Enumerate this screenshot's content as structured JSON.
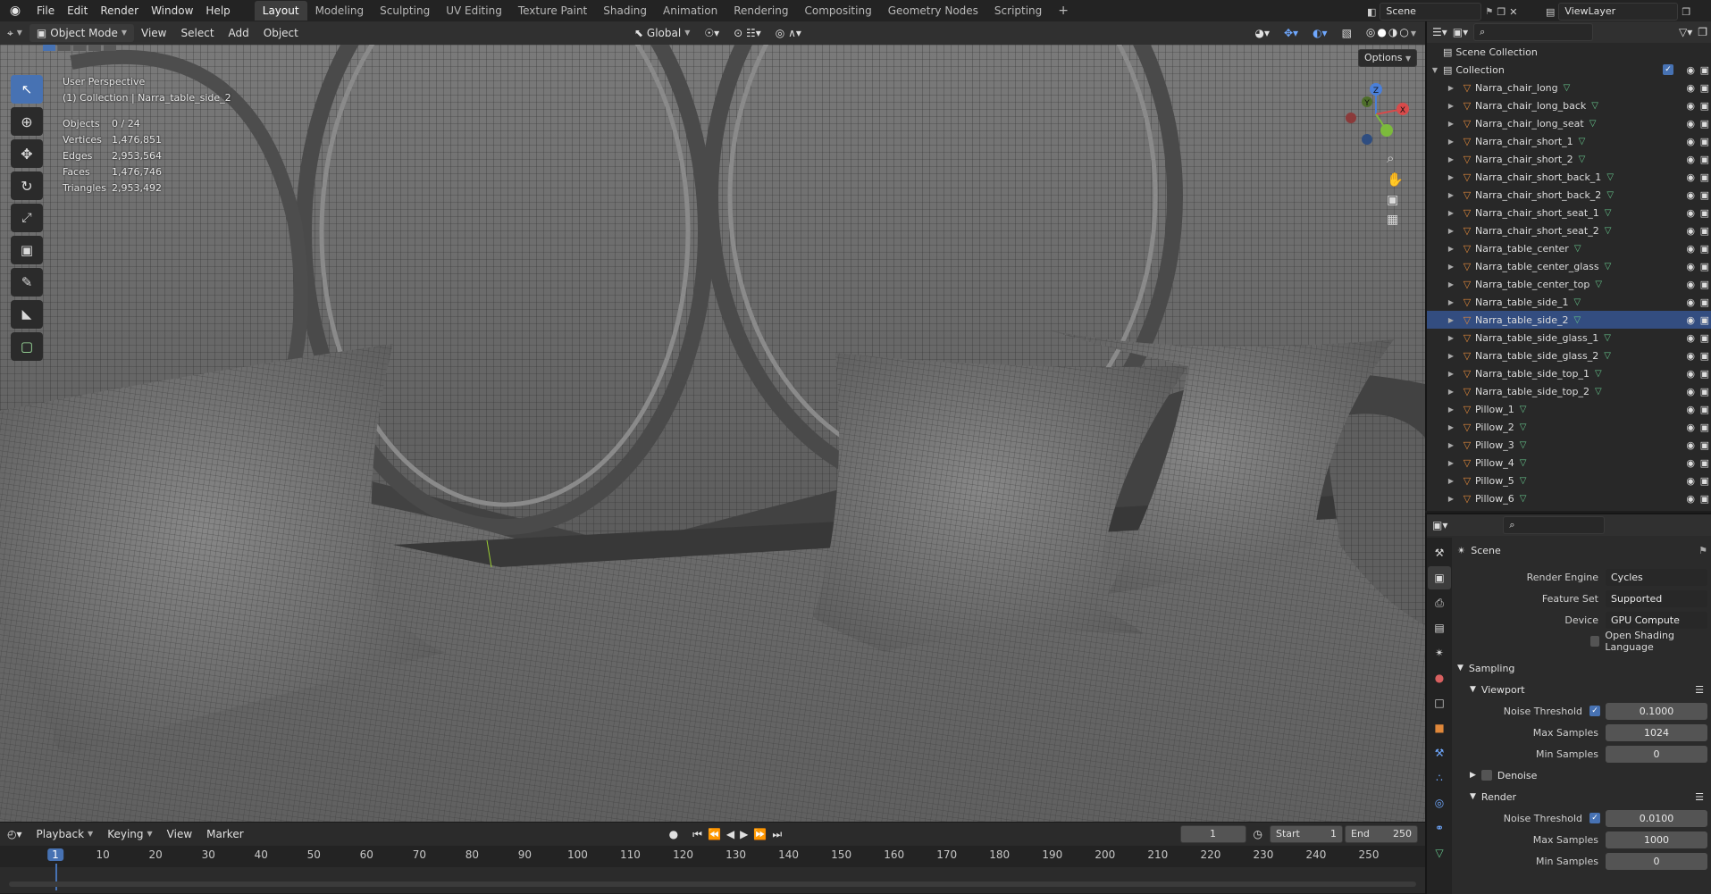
{
  "topbar": {
    "menus": [
      "File",
      "Edit",
      "Render",
      "Window",
      "Help"
    ],
    "workspaces": [
      "Layout",
      "Modeling",
      "Sculpting",
      "UV Editing",
      "Texture Paint",
      "Shading",
      "Animation",
      "Rendering",
      "Compositing",
      "Geometry Nodes",
      "Scripting"
    ],
    "active_workspace": "Layout",
    "add_workspace": "+",
    "scene": "Scene",
    "view_layer": "ViewLayer"
  },
  "viewport_header": {
    "mode": "Object Mode",
    "menus": [
      "View",
      "Select",
      "Add",
      "Object"
    ],
    "transform_orientation": "Global",
    "options": "Options"
  },
  "viewport": {
    "perspective": "User Perspective",
    "collection_info": "(1) Collection | Narra_table_side_2",
    "stats": [
      {
        "label": "Objects",
        "value": "0 / 24"
      },
      {
        "label": "Vertices",
        "value": "1,476,851"
      },
      {
        "label": "Edges",
        "value": "2,953,564"
      },
      {
        "label": "Faces",
        "value": "1,476,746"
      },
      {
        "label": "Triangles",
        "value": "2,953,492"
      }
    ],
    "gizmo": {
      "z": "Z",
      "y": "Y",
      "x": "X"
    }
  },
  "outliner": {
    "scene_collection": "Scene Collection",
    "collection": "Collection",
    "items": [
      "Narra_chair_long",
      "Narra_chair_long_back",
      "Narra_chair_long_seat",
      "Narra_chair_short_1",
      "Narra_chair_short_2",
      "Narra_chair_short_back_1",
      "Narra_chair_short_back_2",
      "Narra_chair_short_seat_1",
      "Narra_chair_short_seat_2",
      "Narra_table_center",
      "Narra_table_center_glass",
      "Narra_table_center_top",
      "Narra_table_side_1",
      "Narra_table_side_2",
      "Narra_table_side_glass_1",
      "Narra_table_side_glass_2",
      "Narra_table_side_top_1",
      "Narra_table_side_top_2",
      "Pillow_1",
      "Pillow_2",
      "Pillow_3",
      "Pillow_4",
      "Pillow_5",
      "Pillow_6"
    ],
    "active_item": "Narra_table_side_2"
  },
  "properties": {
    "context": "Scene",
    "render_engine_label": "Render Engine",
    "render_engine": "Cycles",
    "feature_set_label": "Feature Set",
    "feature_set": "Supported",
    "device_label": "Device",
    "device": "GPU Compute",
    "osl_label": "Open Shading Language",
    "sampling": "Sampling",
    "viewport_section": "Viewport",
    "noise_threshold_label": "Noise Threshold",
    "viewport_noise_threshold": "0.1000",
    "max_samples_label": "Max Samples",
    "viewport_max_samples": "1024",
    "min_samples_label": "Min Samples",
    "viewport_min_samples": "0",
    "denoise": "Denoise",
    "render_section": "Render",
    "render_noise_threshold": "0.0100",
    "render_max_samples": "1000",
    "render_min_samples": "0"
  },
  "timeline": {
    "menus": [
      "Playback",
      "Keying",
      "View",
      "Marker"
    ],
    "current_frame": "1",
    "start_label": "Start",
    "start": "1",
    "end_label": "End",
    "end": "250",
    "ticks": [
      "1",
      "10",
      "20",
      "30",
      "40",
      "50",
      "60",
      "70",
      "80",
      "90",
      "100",
      "110",
      "120",
      "130",
      "140",
      "150",
      "160",
      "170",
      "180",
      "190",
      "200",
      "210",
      "220",
      "230",
      "240",
      "250"
    ]
  }
}
